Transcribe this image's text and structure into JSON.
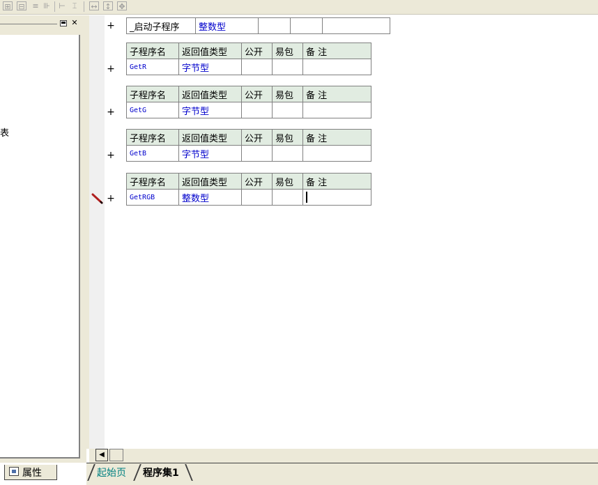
{
  "left_panel": {
    "truncated_text": "表",
    "bottom_tab": {
      "label": "属性",
      "icon": "properties-icon"
    }
  },
  "startup": {
    "name": "_启动子程序",
    "return_type": "整数型"
  },
  "sub_header": {
    "name": "子程序名",
    "return_type": "返回值类型",
    "public": "公开",
    "easy_pack": "易包",
    "remark": "备 注"
  },
  "subs": [
    {
      "name": "GetR",
      "return_type": "字节型"
    },
    {
      "name": "GetG",
      "return_type": "字节型"
    },
    {
      "name": "GetB",
      "return_type": "字节型"
    },
    {
      "name": "GetRGB",
      "return_type": "整数型"
    }
  ],
  "expand_glyph": "+",
  "tabs": [
    "起始页",
    "程序集1"
  ],
  "colors": {
    "header_bg": "#e1ece1",
    "type_text": "#0000cc",
    "tab_start": "#008080",
    "pencil": "#b02020"
  }
}
